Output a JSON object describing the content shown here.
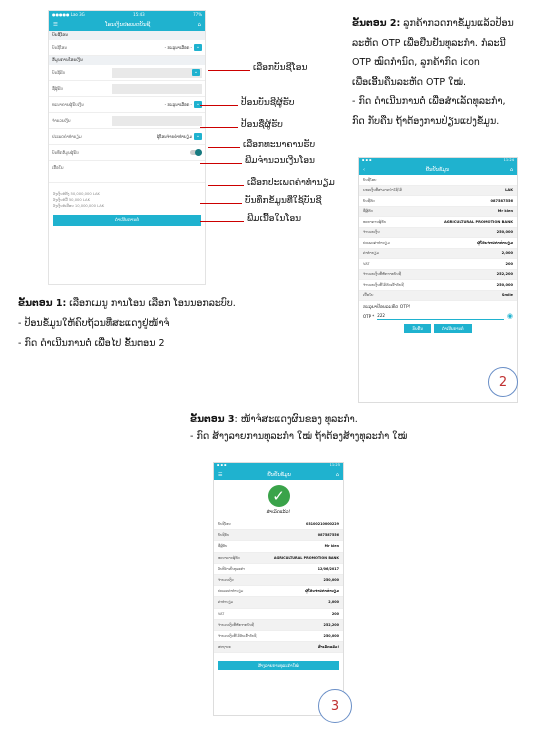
{
  "phone1": {
    "status_left": "●●●●● Lao  3G",
    "status_time": "15:43",
    "status_right": "77%",
    "title": "ໂອນເງິນປະເພດບັນຊີ",
    "section_account": "ບັນຊີໂອນ",
    "account_label": "ບັນຊີໂອນ",
    "account_value": "- ກະລຸນາເລືອກ -",
    "section_receiver": "ຂໍ້ມູນການໂອນເງິນ",
    "to_account_label": "ບັນຊີຮັບ",
    "recipient_label": "ຊື່ຜູ້ຮັບ",
    "bank_label": "ທະນາຄານຜູ້ຮັບເງິນ",
    "bank_value": "- ກະລຸນາເລືອກ -",
    "amount_label": "ຈຳນວນເງິນ",
    "fee_label": "ປະເພດຄ່າທຳນຽມ",
    "fee_value": "ຜູ້ໂອນຈ່າຍຄ່າທຳນຽມ",
    "save_label": "ບັນທຶກຂໍ້ມູນຜູ້ຮັບ",
    "memo_label": "ເນື້ອໃນ",
    "limits": [
      "ວົງເງິນຕໍ່ຄັ້ງ 50,000,000 LAK",
      "ວົງເງິນຕໍ່ມື້ 50,000 LAK",
      "ວົງເງິນຕໍ່ເດືອນ 10,000,000 LAK"
    ],
    "submit_label": "ດຳເນີນການຕໍ່"
  },
  "callouts": {
    "c1": "ເລືອກບັນຊີໂອນ",
    "c2": "ປ້ອນບັນຊີຜູ້ຮັບ",
    "c3": "ປ້ອນຊື່ຜູ້ຮັບ",
    "c4": "ເລືອກທະນາຄານຮັບ",
    "c5": "ພີມຈຳນວນເງີນໂອນ",
    "c6": "ເລືອກປະເພດຄ່າທຳນຽມ",
    "c7": "ບັນທຶກຂໍ້ມູນທີ່ໃຊ້ບັນຊີ",
    "c8": "ພີມເນື້ອໃນໂອນ"
  },
  "step1": {
    "title": "ຂັ້ນຕອນ 1:",
    "title_rest": "  ເລືອກເມນູ ການໂອນ ເລືອກ ໂອນນອກລະບົບ.",
    "lines": [
      "- ປ້ອນຂໍ້ມູນໃຫ້ຄົບຖ້ວນທີ່ສະແດງຢູ່ໜ້າຈໍ",
      "- ກົດ ດຳເນີນການຕໍ່ ເພື່ອໄປ ຂັ້ນຕອນ 2"
    ]
  },
  "step2": {
    "title": "ຂັ້ນຕອນ 2:",
    "lines": [
      " ລູກຄ້າກວດກາຂໍ້ມູນແລ້ວປ້ອນ",
      "ລະຫັດ OTP ເພື່ອຢືນຢັນທຸລະກຳ. ກໍລະນີ",
      "OTP ໝົດກຳນົດ, ລູກຄ້າກົດ icon",
      "ເພື່ອເອີ້ນຄືນລະຫັດ OTP ໃໝ່.",
      "- ກົດ ດຳເນີນການຕໍ່ ເພື່ອສຳເລັດທຸລະກຳ,",
      "ກົດ ກັບຄືນ ຖ້າຕ້ອງການປ່ຽນແປງຂໍ້ມູນ."
    ]
  },
  "step3": {
    "title": "ຂັ້ນຕອນ 3",
    "title_rest": ": ໜ້າຈໍສະແດງຜົນຂອງ    ທຸລະກຳ.",
    "line": "- ກົດ ສ້າງລາຍການທຸລະກຳ ໃໝ່ ຖ້າຕ້ອງສ້າງທຸລະກຳ  ໃໝ່"
  },
  "phone2": {
    "status_time": "11:24",
    "title": "ຢືນຢັນຂໍ້ມູນ",
    "rows": [
      [
        "ບັນຊີໂອນ",
        ""
      ],
      [
        "ຍອດເງິນທີ່ສາມາດນຳໃຊ້ໄດ້",
        "LAK"
      ],
      [
        "ບັນຊີຮັບ",
        "087587556"
      ],
      [
        "ຊື່ຜູ້ຮັບ",
        "Mr kien"
      ],
      [
        "ທະນາຄານຜູ້ຮັບ",
        "AGRICULTURAL PROMOTION BANK"
      ],
      [
        "ຈຳນວນເງິນ",
        "250,000"
      ],
      [
        "ປະເພດຄ່າທຳນຽມ",
        "ຜູ້ໂອນຈ່າຍຄ່າທຳນຽມ"
      ],
      [
        "ຄ່າທຳນຽມ",
        "2,000"
      ],
      [
        "VAT",
        "200"
      ],
      [
        "ຈຳນວນເງິນທີ່ຫັກຈາກບັນຊີ",
        "252,200"
      ],
      [
        "ຈຳນວນເງິນທີ່ໄດ້ຮັບເຂົ້າບັນຊີ",
        "250,000"
      ],
      [
        "ເນື້ອໃນ",
        "Smile"
      ]
    ],
    "otp_prompt": "ກະລຸນາປ້ອນລະຫັດ OTP!",
    "otp_label": "OTP *",
    "otp_value": "222",
    "back_label": "ກັບຄືນ",
    "next_label": "ດຳເນີນການຕໍ່",
    "badge": "2"
  },
  "phone3": {
    "status_time": "11:25",
    "title": "ຢືນຢັນຂໍ້ມູນ",
    "success": "ສຳເລັດແລ້ວ!",
    "rows": [
      [
        "ບັນຊີໂອນ",
        "03100210000229"
      ],
      [
        "ບັນຊີຮັບ",
        "087587556"
      ],
      [
        "ຊື່ຜູ້ຮັບ",
        "Mr kien"
      ],
      [
        "ທະນາຄານຜູ້ຮັບ",
        "AGRICULTURAL PROMOTION BANK"
      ],
      [
        "ວັນທີດຳເນີນທຸລະກຳ",
        "12/06/2017"
      ],
      [
        "ຈຳນວນເງິນ",
        "250,000"
      ],
      [
        "ປະເພດຄ່າທຳນຽມ",
        "ຜູ້ໂອນຈ່າຍຄ່າທຳນຽມ"
      ],
      [
        "ຄ່າທຳນຽມ",
        "2,000"
      ],
      [
        "VAT",
        "200"
      ],
      [
        "ຈຳນວນເງິນທີ່ຫັກຈາກບັນຊີ",
        "252,200"
      ],
      [
        "ຈຳນວນເງິນທີ່ໄດ້ຮັບເຂົ້າບັນຊີ",
        "250,000"
      ],
      [
        "ສະຖານະ",
        "ສຳເລັດແລ້ວ!"
      ]
    ],
    "new_label": "ສ້າງລາຍການທຸລະກຳໃໝ່",
    "badge": "3"
  },
  "colors": {
    "accent": "#1fb2cf",
    "callout": "#cc0000"
  }
}
